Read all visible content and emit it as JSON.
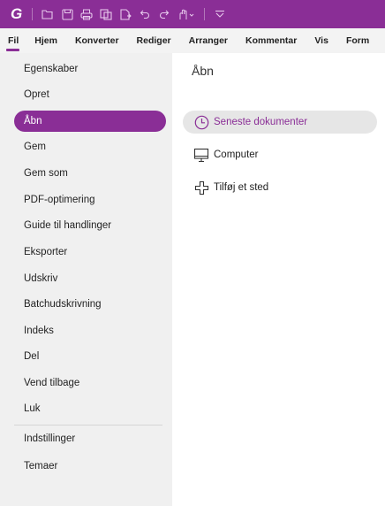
{
  "colors": {
    "accent": "#8a2e96",
    "nav_bg": "#f0f0f0",
    "selected_option_bg": "#e6e6e6"
  },
  "toolbar": {
    "logo": "G",
    "icons": [
      "open-folder-icon",
      "save-icon",
      "print-icon",
      "copy-icon",
      "export-icon",
      "undo-icon",
      "redo-icon",
      "hand-tool-icon",
      "customize-toolbar-icon"
    ]
  },
  "ribbon": {
    "tabs": [
      {
        "label": "Fil",
        "active": true
      },
      {
        "label": "Hjem"
      },
      {
        "label": "Konverter"
      },
      {
        "label": "Rediger"
      },
      {
        "label": "Arranger"
      },
      {
        "label": "Kommentar"
      },
      {
        "label": "Vis"
      },
      {
        "label": "Form"
      }
    ]
  },
  "nav": {
    "items": [
      {
        "label": "Egenskaber"
      },
      {
        "label": "Opret"
      },
      {
        "label": "Åbn",
        "selected": true
      },
      {
        "label": "Gem"
      },
      {
        "label": "Gem som"
      },
      {
        "label": "PDF-optimering"
      },
      {
        "label": "Guide til handlinger"
      },
      {
        "label": "Eksporter"
      },
      {
        "label": "Udskriv"
      },
      {
        "label": "Batchudskrivning"
      },
      {
        "label": "Indeks"
      },
      {
        "label": "Del"
      },
      {
        "label": "Vend tilbage"
      },
      {
        "label": "Luk"
      },
      {
        "label": "Indstillinger"
      },
      {
        "label": "Temaer"
      }
    ]
  },
  "content": {
    "title": "Åbn",
    "options": [
      {
        "label": "Seneste dokumenter",
        "icon": "clock-icon",
        "selected": true
      },
      {
        "label": "Computer",
        "icon": "computer-icon"
      },
      {
        "label": "Tilføj et sted",
        "icon": "add-place-icon"
      }
    ]
  }
}
